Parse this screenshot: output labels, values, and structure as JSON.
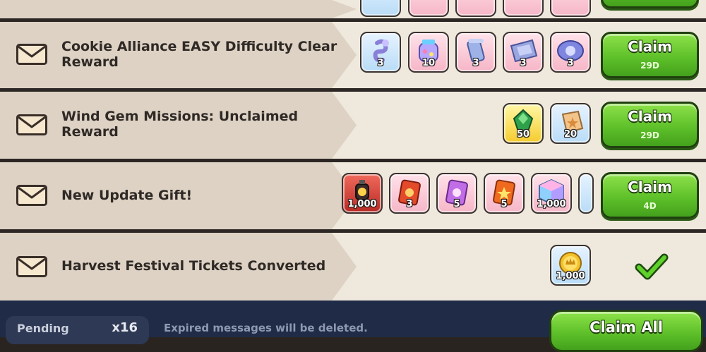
{
  "messages": [
    {
      "title": "Cookie Alliance EASY Difficulty Clear Reward",
      "rewards": [
        {
          "icon": "swirl-cookie-item-icon",
          "qty": "3",
          "bg": "blue"
        },
        {
          "icon": "candy-jar-item-icon",
          "qty": "10",
          "bg": "pink"
        },
        {
          "icon": "scroll-item-icon",
          "qty": "3",
          "bg": "pink"
        },
        {
          "icon": "crystal-slab-item-icon",
          "qty": "3",
          "bg": "pink"
        },
        {
          "icon": "orb-ring-item-icon",
          "qty": "3",
          "bg": "pink"
        }
      ],
      "claim_label": "Claim",
      "expires": "29D"
    },
    {
      "title": "Wind Gem Missions: Unclaimed Reward",
      "rewards": [
        {
          "icon": "wind-gem-item-icon",
          "qty": "50",
          "bg": "yellow"
        },
        {
          "icon": "star-fragment-item-icon",
          "qty": "20",
          "bg": "blue"
        }
      ],
      "claim_label": "Claim",
      "expires": "29D"
    },
    {
      "title": "New Update Gift!",
      "rewards": [
        {
          "icon": "lantern-item-icon",
          "qty": "1,000",
          "bg": "red"
        },
        {
          "icon": "red-card-item-icon",
          "qty": "3",
          "bg": "pink"
        },
        {
          "icon": "purple-card-item-icon",
          "qty": "5",
          "bg": "pink"
        },
        {
          "icon": "orange-card-item-icon",
          "qty": "5",
          "bg": "pink"
        },
        {
          "icon": "rainbow-cube-item-icon",
          "qty": "1,000",
          "bg": "pink"
        }
      ],
      "claim_label": "Claim",
      "expires": "4D"
    },
    {
      "title": "Harvest Festival Tickets Converted",
      "rewards": [
        {
          "icon": "gold-coin-item-icon",
          "qty": "1,000",
          "bg": "blue"
        }
      ],
      "claimed": true
    }
  ],
  "footer": {
    "pending_label": "Pending",
    "pending_count": "x16",
    "note": "Expired messages will be deleted.",
    "claim_all_label": "Claim All"
  },
  "colors": {
    "row_bg": "#efe8dc",
    "banner_bg": "#ddd2c4",
    "claim_green": "#5fc12a",
    "footer_bg": "#1f2b47"
  }
}
